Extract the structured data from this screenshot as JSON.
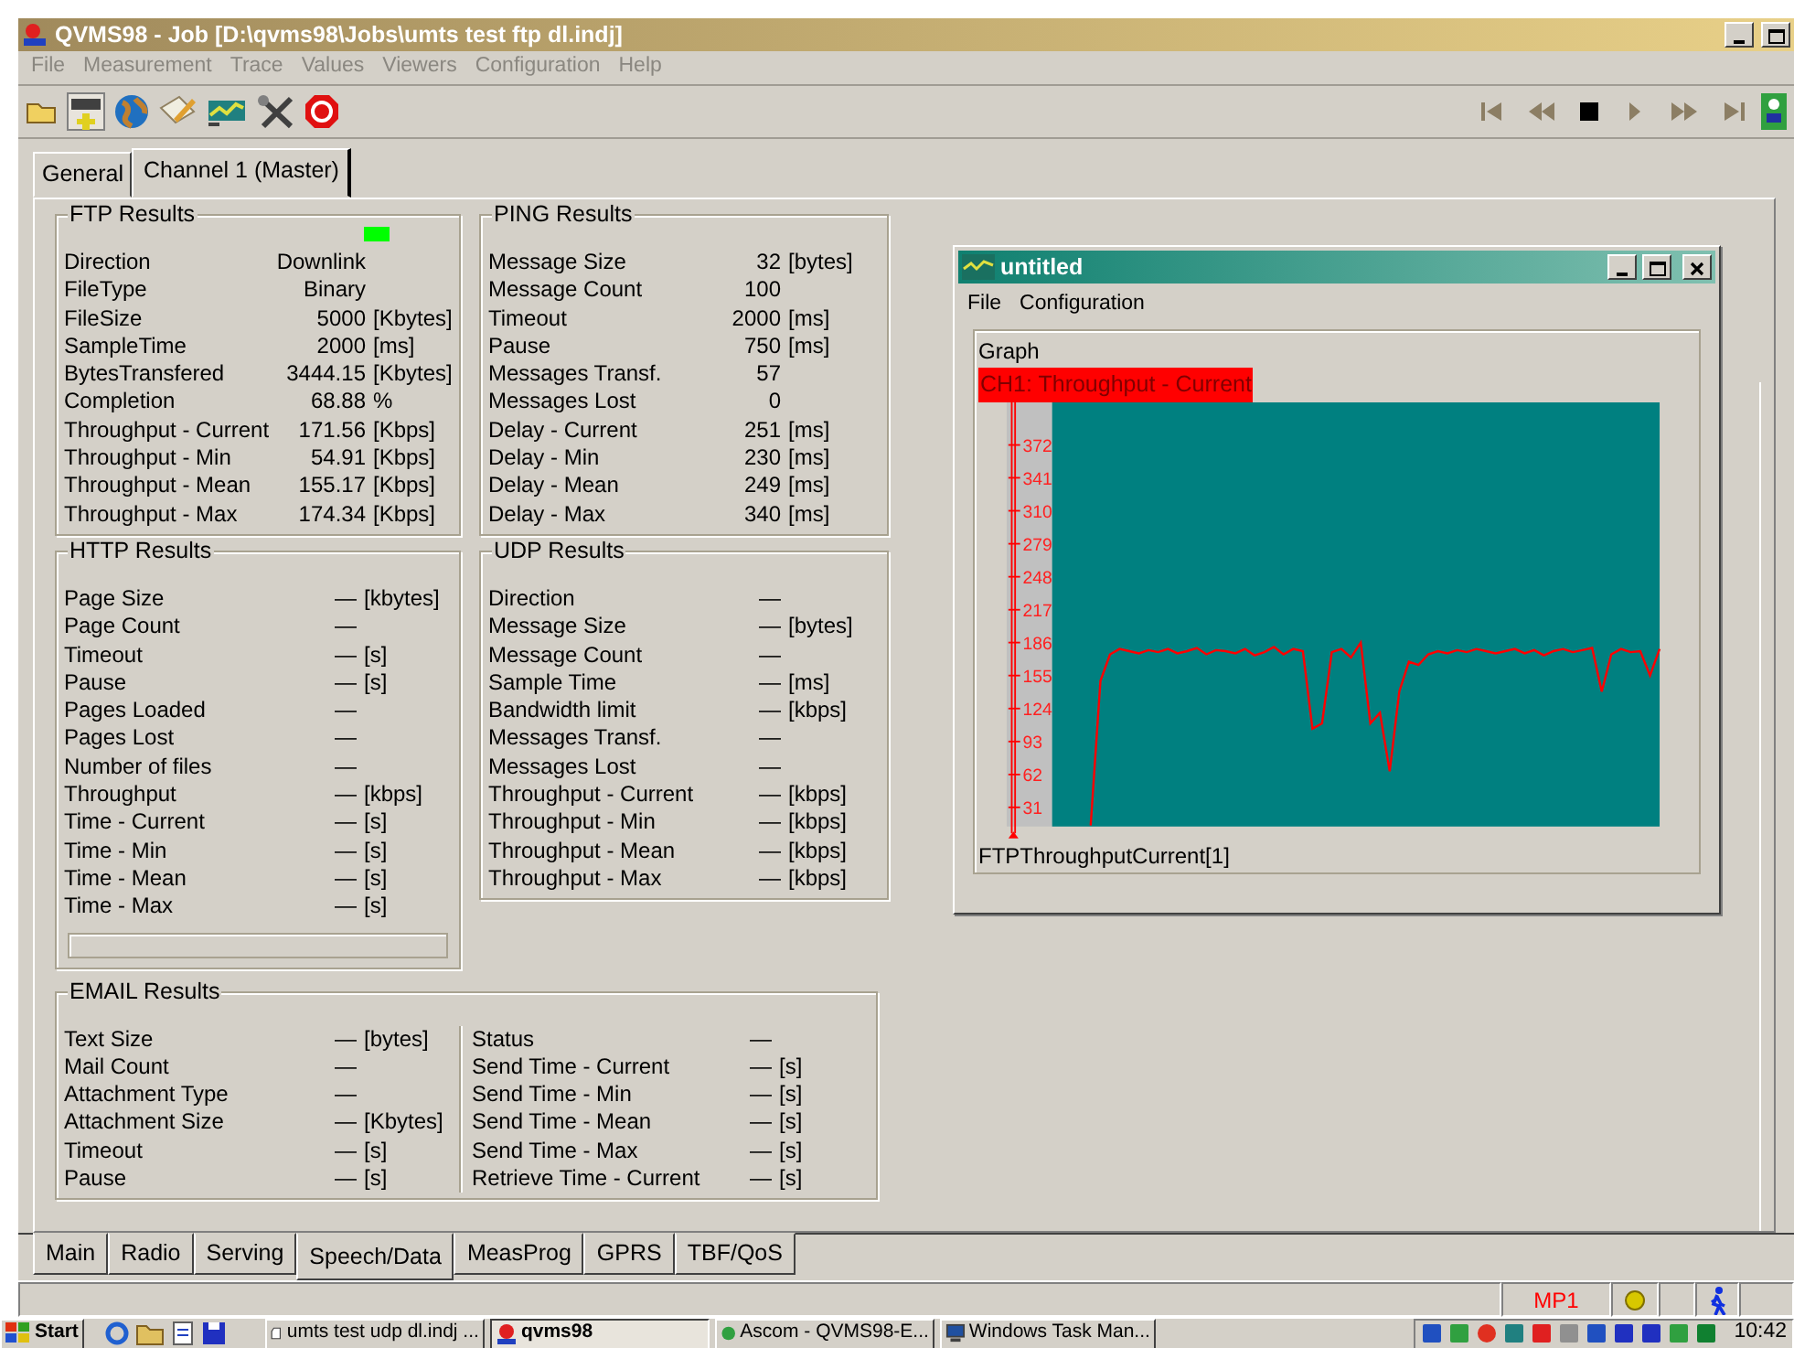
{
  "window": {
    "title": "QVMS98 - Job [D:\\qvms98\\Jobs\\umts test ftp dl.indj]"
  },
  "menu": [
    "File",
    "Measurement",
    "Trace",
    "Values",
    "Viewers",
    "Configuration",
    "Help"
  ],
  "top_tabs": [
    {
      "label": "General",
      "selected": false
    },
    {
      "label": "Channel 1 (Master)",
      "selected": true
    }
  ],
  "groups": [
    {
      "title": "FTP Results",
      "indicator_on": true,
      "rows": [
        [
          "Direction",
          "Downlink"
        ],
        [
          "FileType",
          "Binary"
        ],
        [
          "FileSize",
          "5000",
          "[Kbytes]"
        ],
        [
          "SampleTime",
          "2000",
          "[ms]"
        ],
        [
          "BytesTransfered",
          "3444.15",
          "[Kbytes]"
        ],
        [
          "Completion",
          "68.88",
          "%"
        ],
        [
          "Throughput - Current",
          "171.56",
          "[Kbps]"
        ],
        [
          "Throughput - Min",
          "54.91",
          "[Kbps]"
        ],
        [
          "Throughput - Mean",
          "155.17",
          "[Kbps]"
        ],
        [
          "Throughput - Max",
          "174.34",
          "[Kbps]"
        ]
      ]
    },
    {
      "title": "PING Results",
      "rows": [
        [
          "Message Size",
          "32",
          "[bytes]"
        ],
        [
          "Message Count",
          "100"
        ],
        [
          "Timeout",
          "2000",
          "[ms]"
        ],
        [
          "Pause",
          "750",
          "[ms]"
        ],
        [
          "Messages Transf.",
          "57"
        ],
        [
          "Messages Lost",
          "0"
        ],
        [
          "Delay - Current",
          "251",
          "[ms]"
        ],
        [
          "Delay - Min",
          "230",
          "[ms]"
        ],
        [
          "Delay - Mean",
          "249",
          "[ms]"
        ],
        [
          "Delay - Max",
          "340",
          "[ms]"
        ]
      ]
    },
    {
      "title": "HTTP Results",
      "progress": true,
      "rows": [
        [
          "Page Size",
          "—",
          "[kbytes]"
        ],
        [
          "Page Count",
          "—"
        ],
        [
          "Timeout",
          "—",
          "[s]"
        ],
        [
          "Pause",
          "—",
          "[s]"
        ],
        [
          "Pages Loaded",
          "—"
        ],
        [
          "Pages Lost",
          "—"
        ],
        [
          "Number of files",
          "—"
        ],
        [
          "Throughput",
          "—",
          "[kbps]"
        ],
        [
          "Time - Current",
          "—",
          "[s]"
        ],
        [
          "Time - Min",
          "—",
          "[s]"
        ],
        [
          "Time - Mean",
          "—",
          "[s]"
        ],
        [
          "Time - Max",
          "—",
          "[s]"
        ]
      ]
    },
    {
      "title": "UDP Results",
      "rows": [
        [
          "Direction",
          "—"
        ],
        [
          "Message Size",
          "—",
          "[bytes]"
        ],
        [
          "Message Count",
          "—"
        ],
        [
          "Sample Time",
          "—",
          "[ms]"
        ],
        [
          "Bandwidth limit",
          "—",
          "[kbps]"
        ],
        [
          "Messages Transf.",
          "—"
        ],
        [
          "Messages Lost",
          "—"
        ],
        [
          "Throughput - Current",
          "—",
          "[kbps]"
        ],
        [
          "Throughput - Min",
          "—",
          "[kbps]"
        ],
        [
          "Throughput - Mean",
          "—",
          "[kbps]"
        ],
        [
          "Throughput - Max",
          "—",
          "[kbps]"
        ]
      ]
    },
    {
      "title": "EMAIL Results",
      "rows": [
        [
          "Text Size",
          "—",
          "[bytes]"
        ],
        [
          "Mail Count",
          "—"
        ],
        [
          "Attachment Type",
          "—"
        ],
        [
          "Attachment Size",
          "—",
          "[Kbytes]"
        ],
        [
          "Timeout",
          "—",
          "[s]"
        ],
        [
          "Pause",
          "—",
          "[s]"
        ]
      ],
      "rows_right": [
        [
          "Status",
          "—"
        ],
        [
          "Send Time - Current",
          "—",
          "[s]"
        ],
        [
          "Send Time - Min",
          "—",
          "[s]"
        ],
        [
          "Send Time - Mean",
          "—",
          "[s]"
        ],
        [
          "Send Time - Max",
          "—",
          "[s]"
        ],
        [
          "Retrieve Time - Current",
          "—",
          "[s]"
        ]
      ]
    }
  ],
  "graph_window": {
    "title": "untitled",
    "menu": [
      "File",
      "Configuration"
    ],
    "panel_label": "Graph",
    "legend": "CH1: Throughput - Current",
    "footer": "FTPThroughputCurrent[1]",
    "chart_data": {
      "type": "line",
      "ylim": [
        13,
        412
      ],
      "yticks": [
        31,
        62,
        93,
        124,
        155,
        186,
        217,
        248,
        279,
        310,
        341,
        372
      ],
      "series": [
        {
          "color": "#ff0000",
          "values": [
            null,
            null,
            null,
            null,
            14,
            150,
            175,
            180,
            178,
            176,
            179,
            177,
            180,
            176,
            178,
            181,
            175,
            179,
            178,
            176,
            180,
            174,
            177,
            182,
            175,
            180,
            178,
            105,
            110,
            177,
            180,
            172,
            186,
            110,
            120,
            65,
            140,
            168,
            165,
            175,
            178,
            176,
            179,
            177,
            180,
            178,
            176,
            178,
            180,
            176,
            179,
            174,
            178,
            180,
            177,
            179,
            181,
            140,
            175,
            180,
            177,
            178,
            155,
            180
          ]
        }
      ]
    }
  },
  "bottom_tabs": [
    {
      "label": "Main",
      "selected": false
    },
    {
      "label": "Radio",
      "selected": false
    },
    {
      "label": "Serving",
      "selected": false
    },
    {
      "label": "Speech/Data",
      "selected": true
    },
    {
      "label": "MeasProg",
      "selected": false
    },
    {
      "label": "GPRS",
      "selected": false
    },
    {
      "label": "TBF/QoS",
      "selected": false
    }
  ],
  "status_bar": {
    "mode": "MP1"
  },
  "taskbar": {
    "start": "Start",
    "tasks": [
      {
        "label": "umts test udp dl.indj ...",
        "selected": false
      },
      {
        "label": "qvms98",
        "selected": true
      },
      {
        "label": "Ascom - QVMS98-E...",
        "selected": false
      },
      {
        "label": "Windows Task Man...",
        "selected": false
      }
    ],
    "clock": "10:42"
  }
}
